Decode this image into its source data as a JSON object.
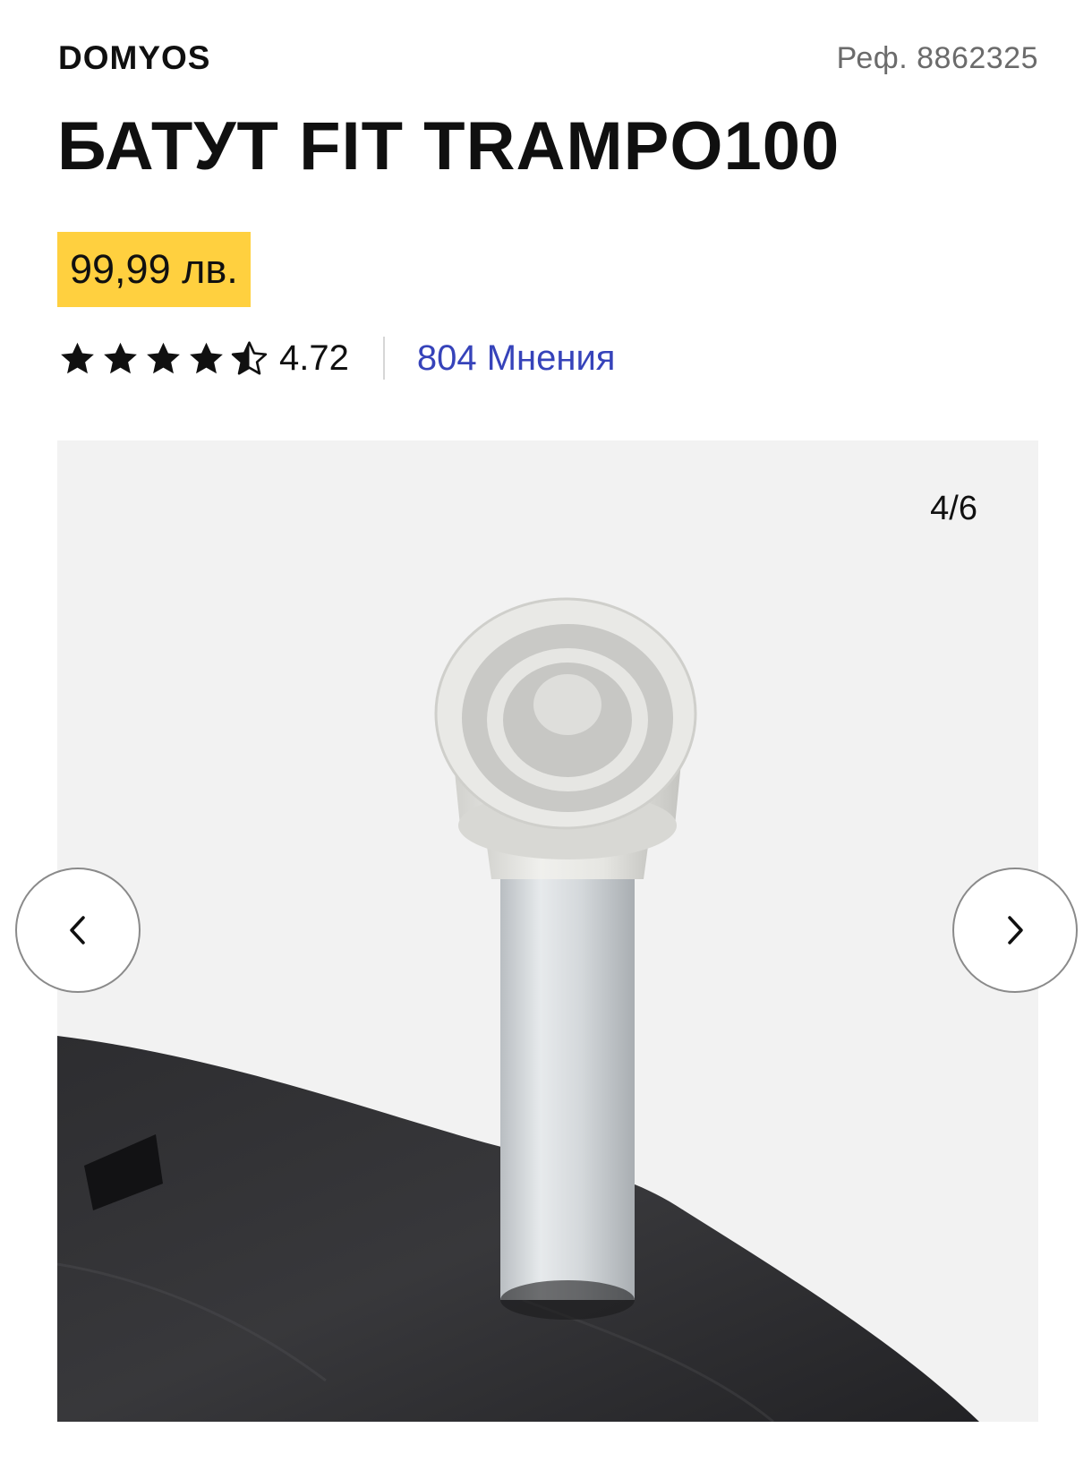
{
  "product": {
    "brand": "DOMYOS",
    "ref": "Реф. 8862325",
    "title": "БАТУТ FIT TRAMPO100",
    "price": "99,99 лв."
  },
  "rating": {
    "stars_value": 4.72,
    "value_text": "4.72",
    "reviews_label": "804 Мнения"
  },
  "gallery": {
    "counter": "4/6",
    "current": 4,
    "total": 6,
    "image_subject": "trampoline leg with grey rubber end cap in black cover"
  },
  "icons": {
    "prev": "chevron-left-icon",
    "next": "chevron-right-icon",
    "star": "star-icon"
  },
  "colors": {
    "price_bg": "#ffd03f",
    "link": "#3643ba",
    "text": "#101010",
    "muted": "#6b6b6b"
  }
}
